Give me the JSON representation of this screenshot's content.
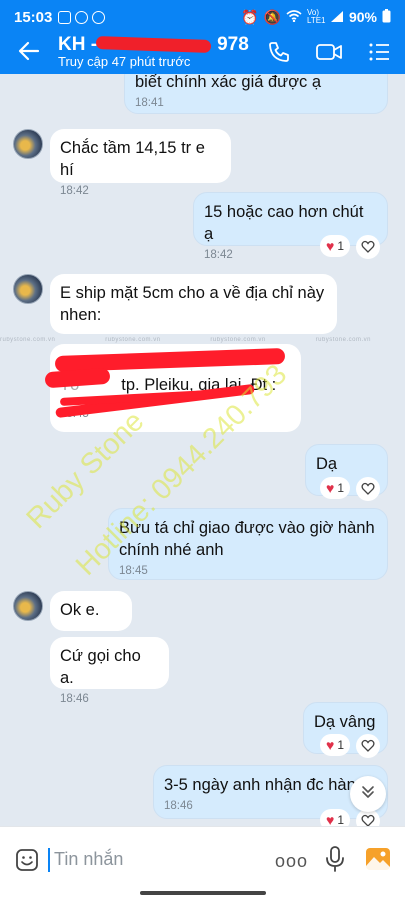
{
  "status_bar": {
    "time": "15:03",
    "network": "Vo) LTE1",
    "battery": "90%"
  },
  "header": {
    "title": "KH -",
    "title_suffix": "978",
    "subtitle": "Truy cập 47 phút trước",
    "icons": [
      "back-arrow-icon",
      "phone-icon",
      "video-call-icon",
      "list-menu-icon"
    ]
  },
  "messages": [
    {
      "side": "me",
      "text": "biết chính xác giá được ạ",
      "time": "18:41"
    },
    {
      "side": "them",
      "text": "Chắc tầm 14,15 tr e hí",
      "time": "18:42"
    },
    {
      "side": "me",
      "text": "15 hoặc cao hơn chút ạ",
      "time": "18:42",
      "reaction": "1"
    },
    {
      "side": "them",
      "text": "E ship mặt 5cm cho a về địa chỉ này nhen:"
    },
    {
      "side": "them",
      "text": "tp. Pleiku, gia lai. Đt :",
      "text_prefix": "Tổ",
      "time": "18:45"
    },
    {
      "side": "me",
      "text": "Dạ",
      "reaction": "1"
    },
    {
      "side": "me",
      "text": "Bưu tá chỉ giao được vào giờ hành chính nhé anh",
      "time": "18:45"
    },
    {
      "side": "them",
      "text": "Ok e."
    },
    {
      "side": "them",
      "text": "Cứ gọi cho a.",
      "time": "18:46"
    },
    {
      "side": "me",
      "text": "Dạ vâng",
      "reaction": "1"
    },
    {
      "side": "me",
      "text": "3-5 ngày anh nhận đc hàn",
      "time": "18:46",
      "reaction": "1"
    }
  ],
  "watermark": {
    "site": "rubystone.com.vn",
    "brand": "Ruby Stone",
    "hotline": "Hotline: 0944.240.793",
    "tag": "RUBY STONE"
  },
  "input": {
    "placeholder": "Tin nhắn",
    "more": "ooo"
  },
  "colors": {
    "header": "#0a84f5",
    "my_bubble": "#d5ebfd",
    "their_bubble": "#ffffff",
    "background": "#e2e9f1",
    "reaction": "#e0314a"
  }
}
